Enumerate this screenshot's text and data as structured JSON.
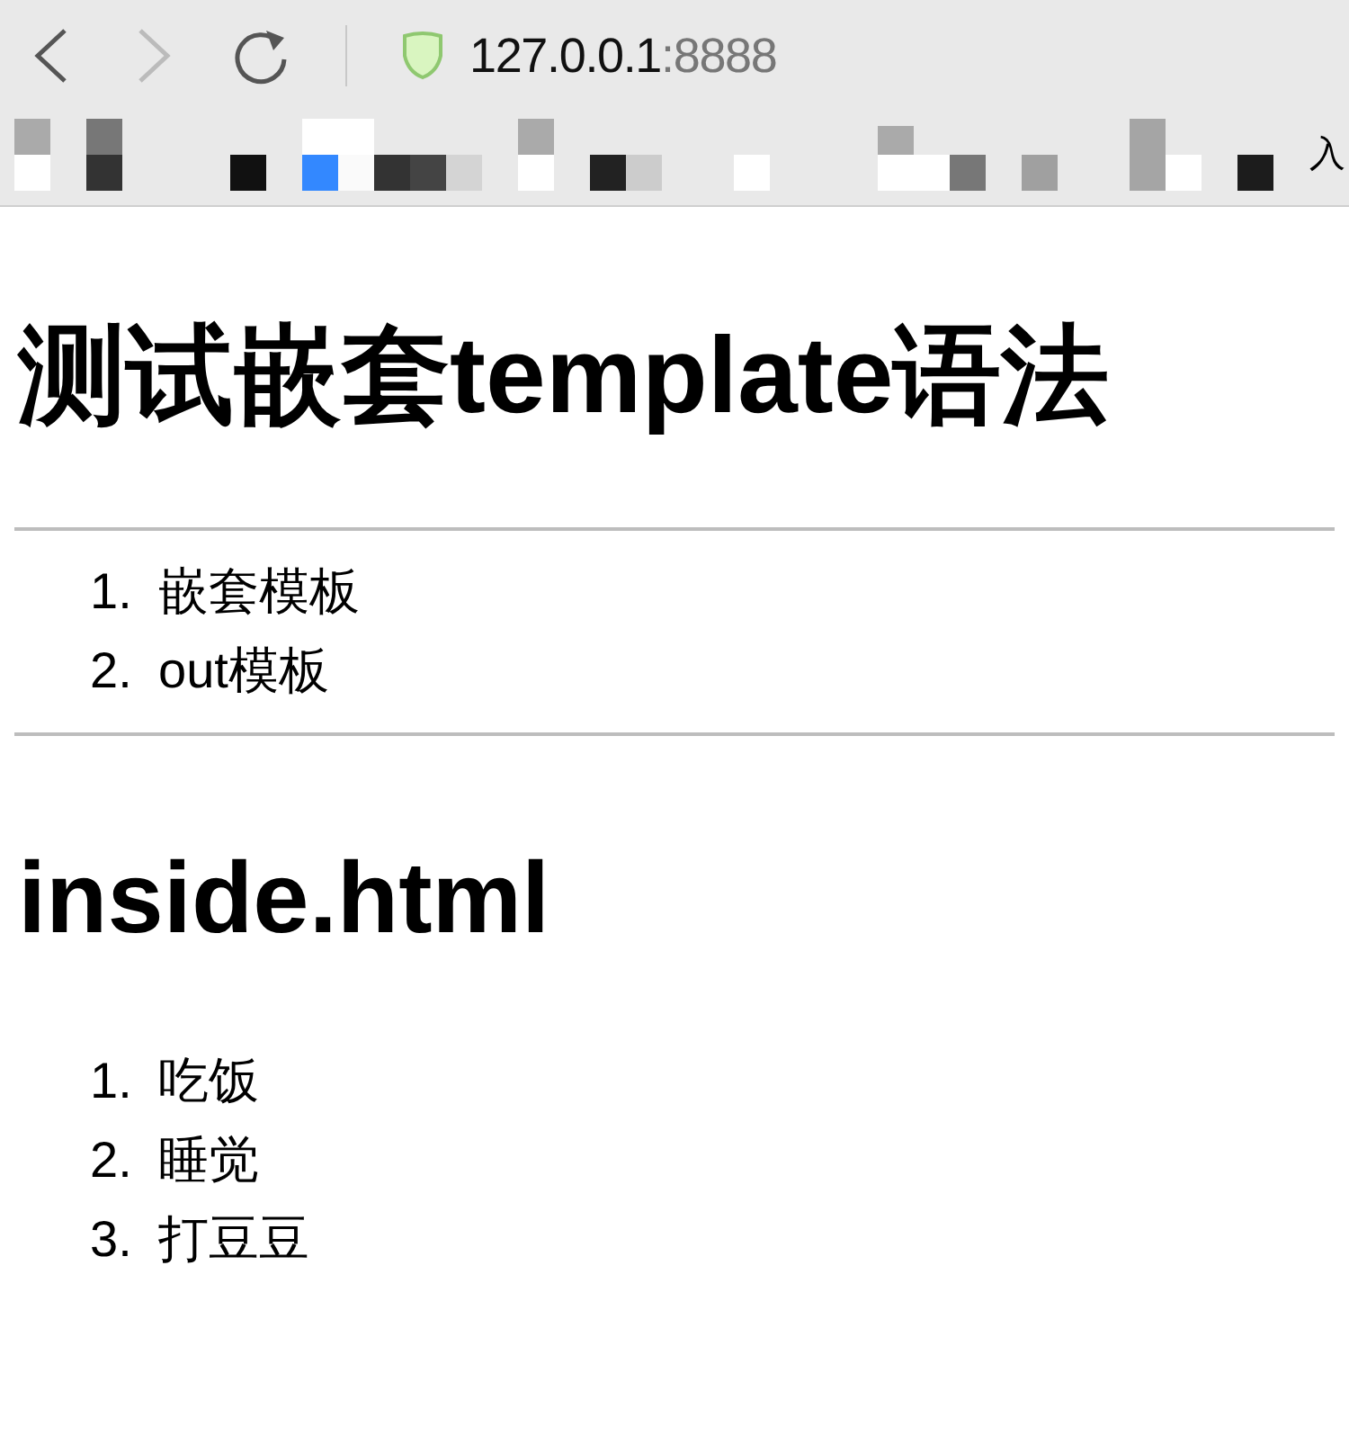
{
  "browser": {
    "address": {
      "host": "127.0.0.1",
      "port": ":8888"
    },
    "bookmarks_bar": {
      "trailing_text": "入"
    }
  },
  "page": {
    "title": "测试嵌套template语法",
    "menu": [
      {
        "number": "1.",
        "text": "嵌套模板"
      },
      {
        "number": "2.",
        "text": "out模板"
      }
    ],
    "section_title": "inside.html",
    "tasks": [
      {
        "number": "1.",
        "text": "吃饭"
      },
      {
        "number": "2.",
        "text": "睡觉"
      },
      {
        "number": "3.",
        "text": "打豆豆"
      }
    ]
  }
}
